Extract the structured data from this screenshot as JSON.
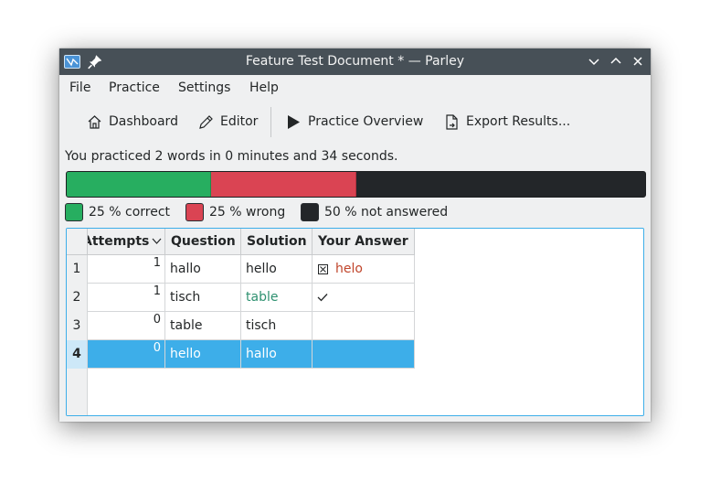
{
  "window": {
    "title": "Feature Test Document * — Parley"
  },
  "menubar": {
    "items": [
      "File",
      "Practice",
      "Settings",
      "Help"
    ]
  },
  "toolbar": {
    "dashboard": "Dashboard",
    "editor": "Editor",
    "practice_overview": "Practice Overview",
    "export_results": "Export Results..."
  },
  "summary": {
    "text": "You practiced 2 words in 0 minutes and 34 seconds."
  },
  "progress": {
    "correct_percent": 25,
    "wrong_percent": 25,
    "not_answered_percent": 50,
    "colors": {
      "correct": "#27ae60",
      "wrong": "#da4453",
      "not_answered": "#232629"
    }
  },
  "legend": {
    "correct": "25 % correct",
    "wrong": "25 % wrong",
    "not_answered": "50 % not answered"
  },
  "table": {
    "headers": [
      "Attempts",
      "Question",
      "Solution",
      "Your Answer"
    ],
    "rows": [
      {
        "num": "1",
        "attempts": "1",
        "question": "hallo",
        "solution": "hello",
        "answer": "helo",
        "answer_icon": "wrong-box-icon"
      },
      {
        "num": "2",
        "attempts": "1",
        "question": "tisch",
        "solution": "table",
        "answer": "",
        "answer_icon": "check-icon"
      },
      {
        "num": "3",
        "attempts": "0",
        "question": "table",
        "solution": "tisch",
        "answer": "",
        "answer_icon": ""
      },
      {
        "num": "4",
        "attempts": "0",
        "question": "hello",
        "solution": "hallo",
        "answer": "",
        "answer_icon": "",
        "selected": true
      }
    ],
    "accent_color": "#3daee9"
  }
}
